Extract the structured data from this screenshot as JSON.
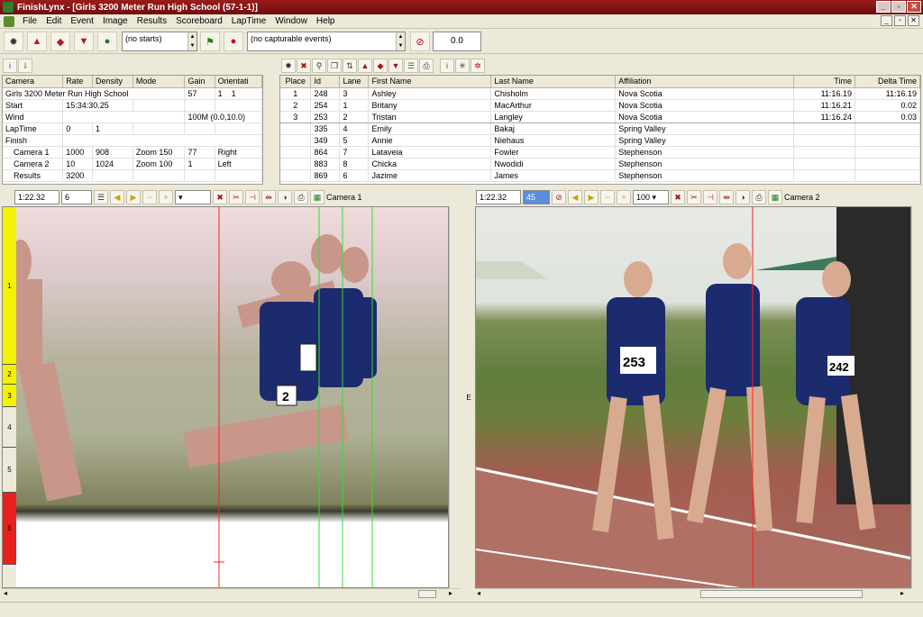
{
  "window": {
    "title": "FinishLynx - [Girls 3200 Meter Run High School (57-1-1)]"
  },
  "menu": [
    "File",
    "Edit",
    "Event",
    "Image",
    "Results",
    "Scoreboard",
    "LapTime",
    "Window",
    "Help"
  ],
  "toolbar": {
    "starts_text": "(no starts)",
    "events_text": "(no capturable events)",
    "counter": "0.0"
  },
  "event_info": {
    "headers": [
      "Camera",
      "Rate",
      "Density",
      "Mode",
      "Gain",
      "Orientati"
    ],
    "rows": [
      [
        "Girls 3200 Meter Run High School",
        "",
        "",
        "",
        "57",
        "1",
        "1"
      ],
      [
        "Start",
        "15:34:30.25",
        "",
        "",
        "",
        "",
        ""
      ],
      [
        "Wind",
        "",
        "",
        "",
        "100M (0.0,10.0)",
        "",
        ""
      ],
      [
        "LapTime",
        "0",
        "",
        "1",
        "",
        "",
        ""
      ],
      [
        "Finish",
        "",
        "",
        "",
        "",
        "",
        ""
      ]
    ],
    "cameras": [
      [
        "Camera 1",
        "1000",
        "908",
        "Zoom 150",
        "77",
        "Right"
      ],
      [
        "Camera 2",
        "10",
        "1024",
        "Zoom 100",
        "1",
        "Left"
      ],
      [
        "Results",
        "3200",
        "",
        "",
        "",
        ""
      ]
    ]
  },
  "results": {
    "headers": [
      "Place",
      "Id",
      "Lane",
      "First Name",
      "Last Name",
      "Affiliation",
      "Time",
      "Delta Time"
    ],
    "rows": [
      [
        "1",
        "248",
        "3",
        "Ashley",
        "Chisholm",
        "Nova Scotia",
        "11:16.19",
        "11:16.19"
      ],
      [
        "2",
        "254",
        "1",
        "Britany",
        "MacArthur",
        "Nova Scotia",
        "11:16.21",
        "0.02"
      ],
      [
        "3",
        "253",
        "2",
        "Tristan",
        "Langley",
        "Nova Scotia",
        "11:16.24",
        "0.03"
      ],
      [
        "",
        "335",
        "4",
        "Emily",
        "Bakaj",
        "Spring Valley",
        "",
        ""
      ],
      [
        "",
        "349",
        "5",
        "Annie",
        "Niehaus",
        "Spring Valley",
        "",
        ""
      ],
      [
        "",
        "864",
        "7",
        "Lataveia",
        "Fowler",
        "Stephenson",
        "",
        ""
      ],
      [
        "",
        "883",
        "8",
        "Chicka",
        "Nwodidi",
        "Stephenson",
        "",
        ""
      ],
      [
        "",
        "869",
        "6",
        "Jazime",
        "James",
        "Stephenson",
        "",
        ""
      ]
    ]
  },
  "camera1": {
    "time": "1:22.32",
    "density": "6",
    "label": "Camera 1",
    "lanes": [
      "1",
      "2",
      "3",
      "4",
      "5",
      "6"
    ]
  },
  "camera2": {
    "time": "1:22.32",
    "density": "45",
    "zoom": "100",
    "label": "Camera 2",
    "edge": "E"
  },
  "bibs": [
    "253",
    "2",
    "242",
    "2"
  ],
  "colors": {
    "title": "#8b1414",
    "lane1": "#f4f200",
    "lane6": "#e8211c",
    "cursor": "#ff2020",
    "marker": "#33dd33"
  }
}
